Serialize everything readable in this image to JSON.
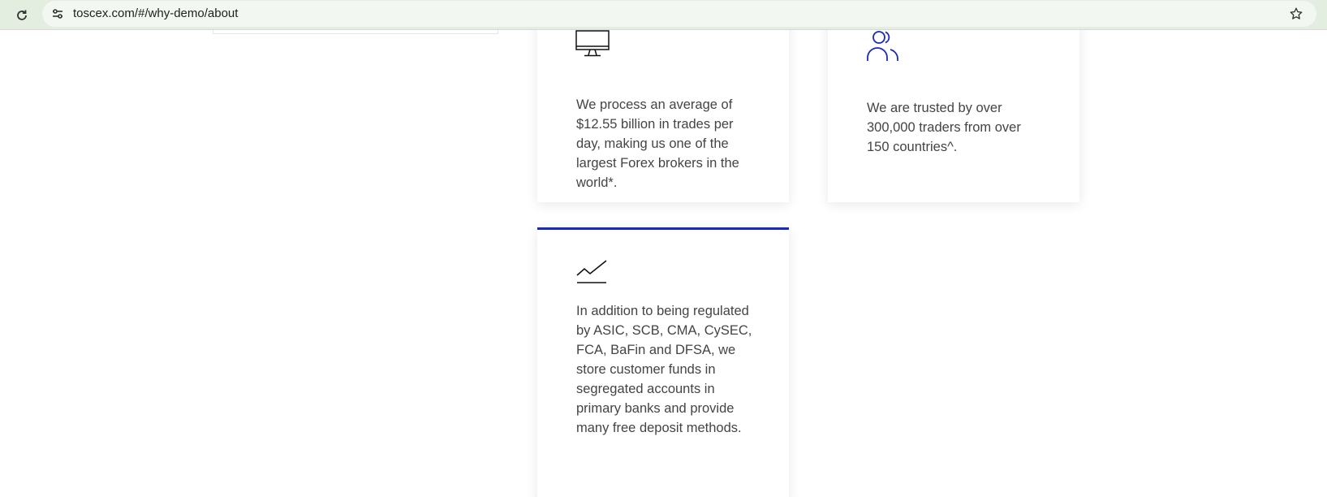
{
  "browser": {
    "url": "toscex.com/#/why-demo/about",
    "reload_icon": "reload-icon",
    "site_info_icon": "tune-icon",
    "bookmark_icon": "star-icon"
  },
  "cards": [
    {
      "icon": "monitor-icon",
      "text": "We process an average of $12.55 billion in trades per day, making us one of the largest Forex brokers in the world*."
    },
    {
      "icon": "users-icon",
      "text": "We are trusted by over 300,000 traders from over 150 countries^."
    },
    {
      "icon": "line-chart-icon",
      "text": "In addition to being regulated by ASIC, SCB, CMA, CySEC, FCA, BaFin and DFSA, we store customer funds in segregated accounts in primary banks and provide many free deposit methods."
    }
  ],
  "colors": {
    "accent": "#1a2ab8",
    "browser_bar": "#e3ede0",
    "text": "#444444"
  }
}
